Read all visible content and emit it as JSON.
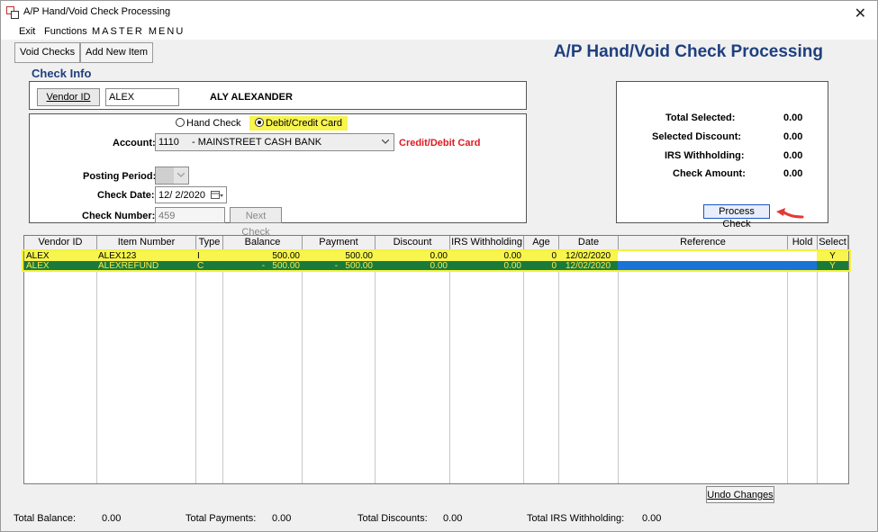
{
  "window": {
    "title": "A/P Hand/Void Check Processing",
    "close_glyph": "✕"
  },
  "menu": {
    "exit": "Exit",
    "functions": "Functions",
    "master_menu": "MASTER MENU"
  },
  "toolbar": {
    "void_checks": "Void Checks",
    "add_new_item": "Add New Item"
  },
  "header_title": "A/P Hand/Void Check Processing",
  "check_info": {
    "section_label": "Check Info",
    "vendor_id_button": "Vendor ID",
    "vendor_id_value": "ALEX",
    "vendor_name": "ALY ALEXANDER",
    "hand_check_label": "Hand Check",
    "debit_credit_label": "Debit/Credit Card",
    "selected_payment": "Debit/Credit Card",
    "account_label": "Account:",
    "account_number": "1110",
    "account_name": "- MAINSTREET CASH BANK",
    "account_note": "Credit/Debit Card",
    "posting_period_label": "Posting Period:",
    "check_date_label": "Check Date:",
    "check_date_value": "12/ 2/2020",
    "check_number_label": "Check Number:",
    "check_number_value": "459",
    "next_check_button": "Next Check"
  },
  "totals_box": {
    "total_selected_label": "Total Selected:",
    "total_selected_value": "0.00",
    "selected_discount_label": "Selected Discount:",
    "selected_discount_value": "0.00",
    "irs_withholding_label": "IRS Withholding:",
    "irs_withholding_value": "0.00",
    "check_amount_label": "Check Amount:",
    "check_amount_value": "0.00",
    "process_check_button": "Process Check"
  },
  "grid": {
    "columns": [
      "Vendor ID",
      "Item Number",
      "Type",
      "Balance",
      "Payment",
      "Discount",
      "IRS Withholding",
      "Age",
      "Date",
      "Reference",
      "Hold",
      "Select"
    ],
    "rows": [
      {
        "vendor_id": "ALEX",
        "item_number": "ALEX123",
        "type": "I",
        "balance": "500.00",
        "payment": "500.00",
        "discount": "0.00",
        "irs": "0.00",
        "age": "0",
        "date": "12/02/2020",
        "reference": "",
        "hold": "",
        "select": "Y"
      },
      {
        "vendor_id": "ALEX",
        "item_number": "ALEXREFUND",
        "type": "C",
        "balance": "-   500.00",
        "payment": "-   500.00",
        "discount": "0.00",
        "irs": "0.00",
        "age": "0",
        "date": "12/02/2020",
        "reference": "",
        "hold": "",
        "select": "Y"
      }
    ]
  },
  "undo_changes_button": "Undo Changes",
  "status_bar": {
    "total_balance_label": "Total Balance:",
    "total_balance_value": "0.00",
    "total_payments_label": "Total Payments:",
    "total_payments_value": "0.00",
    "total_discounts_label": "Total Discounts:",
    "total_discounts_value": "0.00",
    "total_irs_label": "Total IRS Withholding:",
    "total_irs_value": "0.00"
  },
  "colors": {
    "title_blue": "#1f3f7f",
    "highlight_yellow": "#f7f54e",
    "row_green": "#1a7a3a",
    "row_text_yellow": "#ffe84a",
    "selection_blue": "#1a73d6",
    "note_red": "#e0191f",
    "arrow_red": "#e53935"
  }
}
